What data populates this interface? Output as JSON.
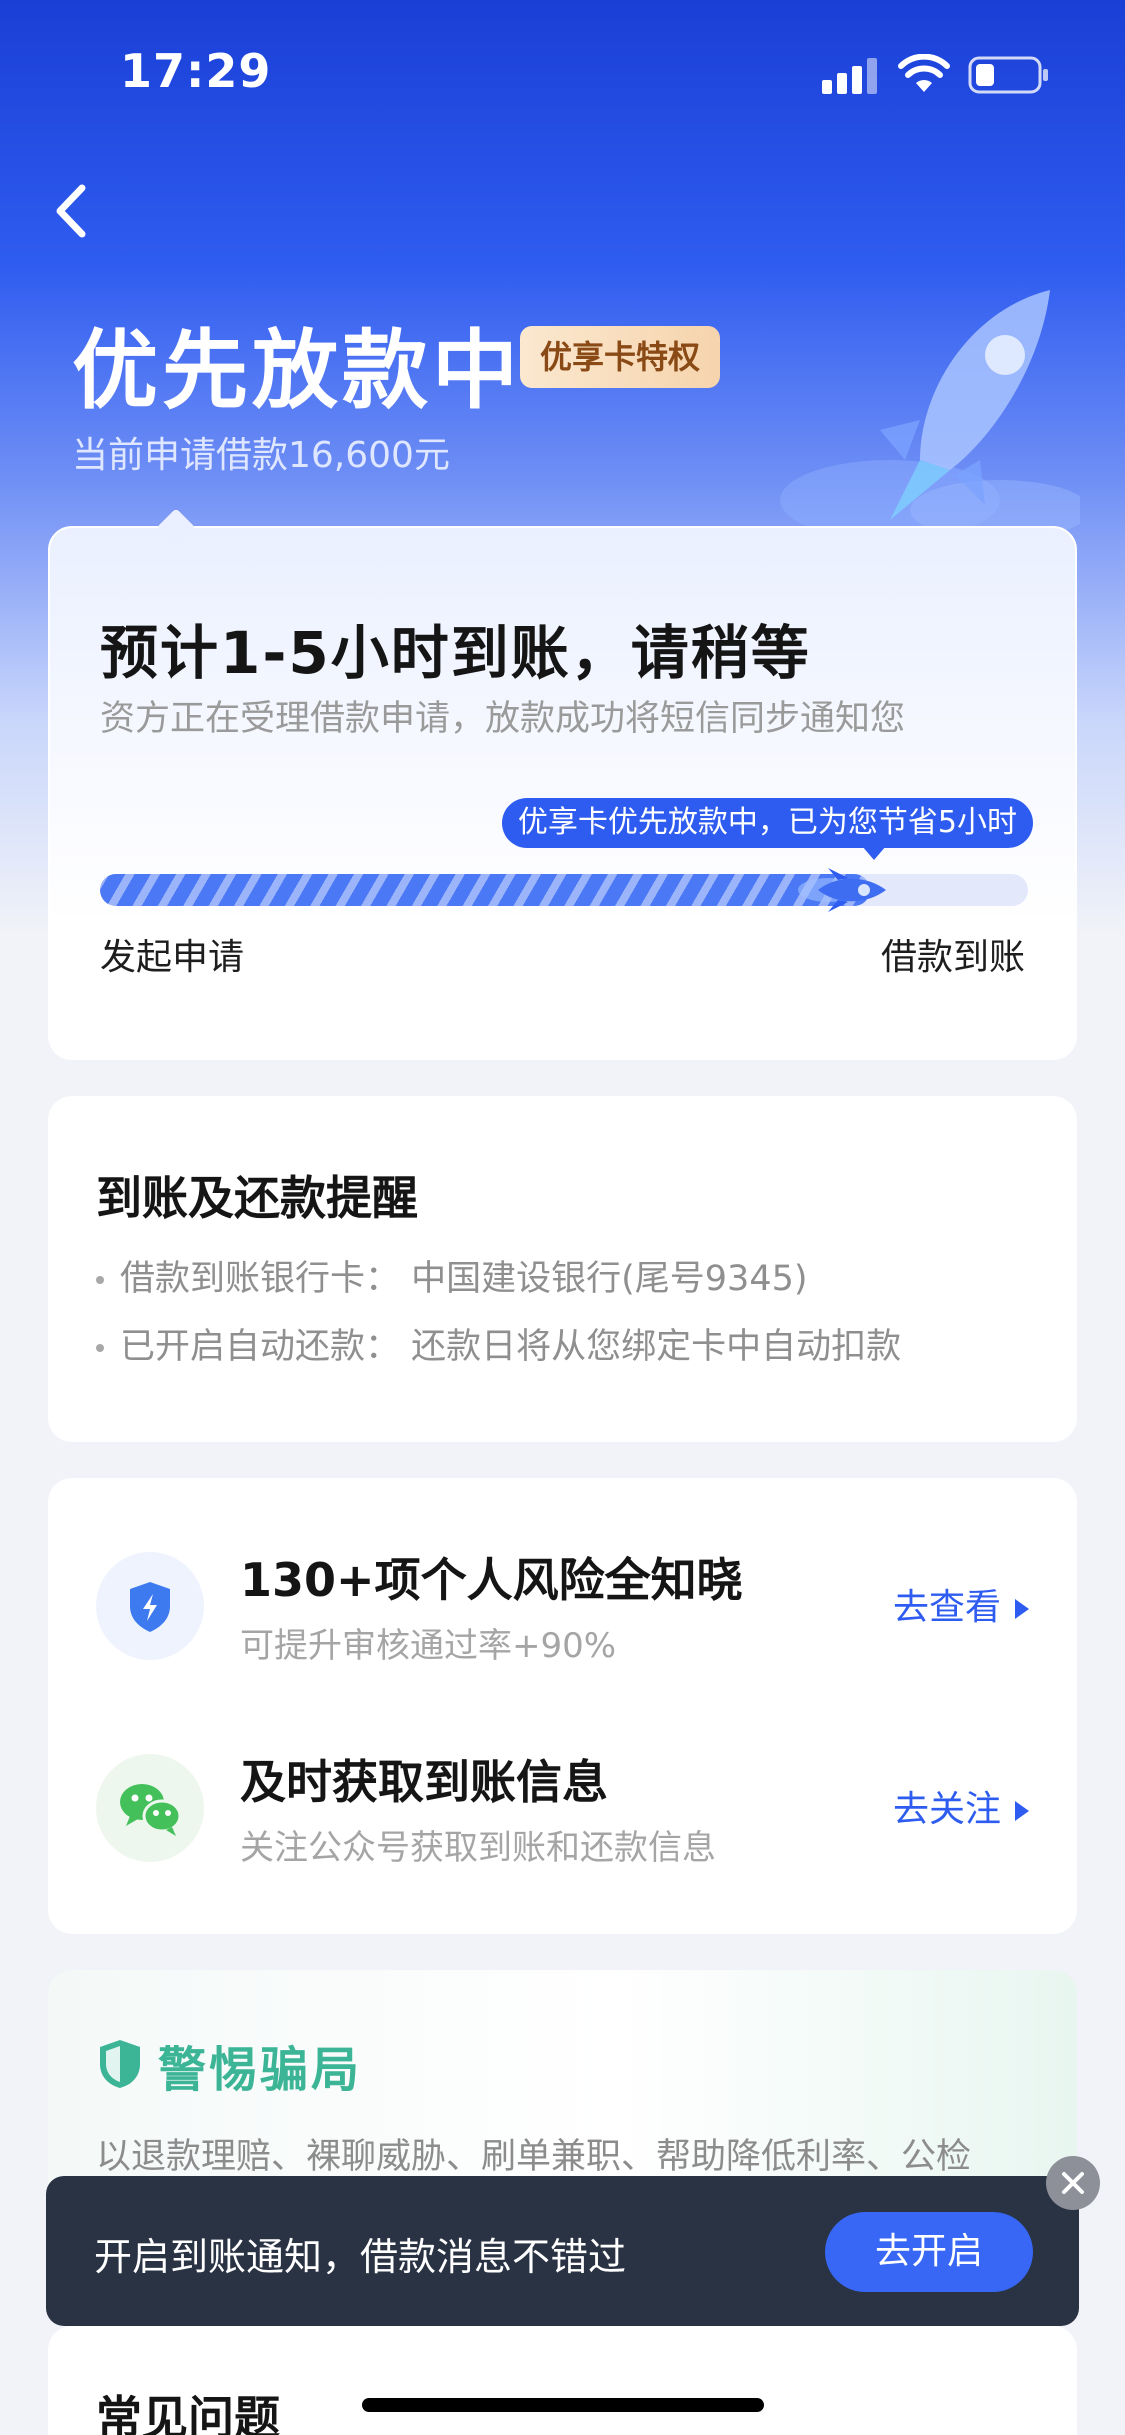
{
  "status_bar": {
    "time": "17:29"
  },
  "header": {
    "title": "优先放款中",
    "badge": "优享卡特权",
    "subtitle": "当前申请借款16,600元"
  },
  "progress_card": {
    "title": "预计1-5小时到账，请稍等",
    "description": "资方正在受理借款申请，放款成功将短信同步通知您",
    "tip": "优享卡优先放款中，已为您节省5小时",
    "progress_fraction": 0.83,
    "start_label": "发起申请",
    "end_label": "借款到账"
  },
  "reminder_card": {
    "title": "到账及还款提醒",
    "lines": [
      "借款到账银行卡：  中国建设银行(尾号9345)",
      "已开启自动还款：  还款日将从您绑定卡中自动扣款"
    ]
  },
  "services": [
    {
      "icon": "shield-bolt-icon",
      "title": "130+项个人风险全知晓",
      "subtitle": "可提升审核通过率+90%",
      "link": "去查看"
    },
    {
      "icon": "wechat-icon",
      "title": "及时获取到账信息",
      "subtitle": "关注公众号获取到账和还款信息",
      "link": "去关注"
    }
  ],
  "fraud_card": {
    "title": "警惕骗局",
    "description": "以退款理赔、裸聊威胁、刷单兼职、帮助降低利率、公检"
  },
  "notify_banner": {
    "text": "开启到账通知，借款消息不错过",
    "button": "去开启"
  },
  "faq_card": {
    "title": "常见问题"
  },
  "colors": {
    "primary": "#2f5cf0",
    "fraud_green": "#3cb496",
    "banner_bg": "#2a3344",
    "badge_text": "#8a4a16"
  }
}
